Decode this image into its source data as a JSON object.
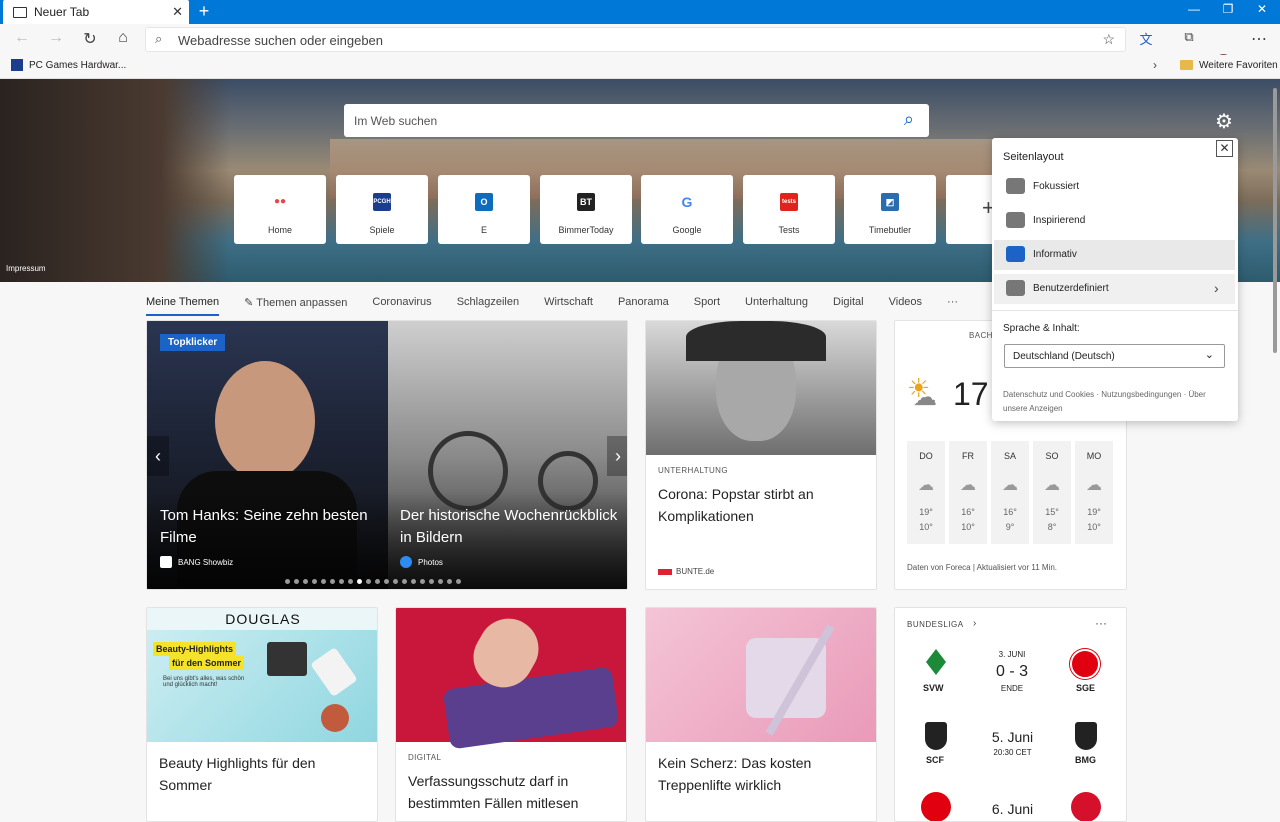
{
  "browser": {
    "tab_title": "Neuer Tab",
    "address_placeholder": "Webadresse suchen oder eingeben"
  },
  "bookmarks": {
    "item1": "PC Games Hardwar...",
    "other": "Weitere Favoriten"
  },
  "hero": {
    "search_placeholder": "Im Web suchen",
    "impressum": "Impressum"
  },
  "tiles": [
    {
      "label": "Home",
      "icon_text": "●●",
      "color": "#e8444a"
    },
    {
      "label": "Spiele",
      "icon_text": "PCGH",
      "color": "#1b3d8f"
    },
    {
      "label": "E",
      "icon_text": "O",
      "color": "#0f6cbd"
    },
    {
      "label": "BimmerToday",
      "icon_text": "BT",
      "color": "#222222"
    },
    {
      "label": "Google",
      "icon_text": "G",
      "color": "#4285f4"
    },
    {
      "label": "Tests",
      "icon_text": "tests",
      "color": "#e0241b"
    },
    {
      "label": "Timebutler",
      "icon_text": "◩",
      "color": "#2b6cb0"
    }
  ],
  "categories": [
    "Meine Themen",
    "✎ Themen anpassen",
    "Coronavirus",
    "Schlagzeilen",
    "Wirtschaft",
    "Panorama",
    "Sport",
    "Unterhaltung",
    "Digital",
    "Videos",
    "···"
  ],
  "carousel": {
    "badge": "Topklicker",
    "left": {
      "title": "Tom Hanks: Seine zehn besten Filme",
      "source": "BANG Showbiz"
    },
    "right": {
      "title": "Der historische Wochenrückblick in Bildern",
      "source": "Photos"
    }
  },
  "cards": {
    "corona": {
      "category": "UNTERHALTUNG",
      "title": "Corona: Popstar stirbt an Komplikationen",
      "source": "BUNTE.de"
    },
    "beauty": {
      "brand": "DOUGLAS",
      "promo1": "Beauty-Highlights",
      "promo2": "für den Sommer",
      "promo3": "Bei uns gibt's alles, was schön und glücklich macht!",
      "title": "Beauty Highlights für den Sommer"
    },
    "digital": {
      "category": "DIGITAL",
      "title": "Verfassungsschutz darf in bestimmten Fällen mitlesen"
    },
    "treppe": {
      "title": "Kein Scherz: Das kosten Treppenlifte wirklich"
    }
  },
  "weather": {
    "location": "BACH",
    "temp": "17",
    "days": [
      {
        "d": "DO",
        "hi": "19°",
        "lo": "10°"
      },
      {
        "d": "FR",
        "hi": "16°",
        "lo": "10°"
      },
      {
        "d": "SA",
        "hi": "16°",
        "lo": "9°"
      },
      {
        "d": "SO",
        "hi": "15°",
        "lo": "8°"
      },
      {
        "d": "MO",
        "hi": "19°",
        "lo": "10°"
      }
    ],
    "footer": "Daten von Foreca | Aktualisiert vor 11 Min."
  },
  "bundesliga": {
    "title": "BUNDESLIGA",
    "m1": {
      "home": "SVW",
      "away": "SGE",
      "date": "3. JUNI",
      "score": "0 - 3",
      "status": "ENDE"
    },
    "m2": {
      "home": "SCF",
      "away": "BMG",
      "date": "5. Juni",
      "time": "20:30 CET"
    },
    "m3": {
      "date": "6. Juni"
    }
  },
  "popup": {
    "header": "Seitenlayout",
    "options": [
      "Fokussiert",
      "Inspirierend",
      "Informativ",
      "Benutzerdefiniert"
    ],
    "lang_label": "Sprache & Inhalt:",
    "lang_value": "Deutschland (Deutsch)",
    "footer": "Datenschutz und Cookies · Nutzungsbedingungen · Über unsere Anzeigen"
  }
}
